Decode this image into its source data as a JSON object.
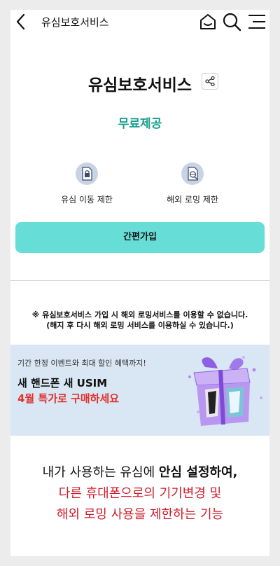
{
  "header": {
    "title": "유심보호서비스"
  },
  "service": {
    "name": "유심보호서비스",
    "price": "무료제공"
  },
  "features": [
    {
      "label": "유심 이동 제한",
      "icon": "sim-lock-icon"
    },
    {
      "label": "해외 로밍 제한",
      "icon": "roaming-block-icon"
    }
  ],
  "join_button": {
    "label": "간편가입"
  },
  "notice": {
    "line1": "※ 유심보호서비스 가입 시 해외 로밍서비스를 이용할 수 없습니다.",
    "line2": "(해지 후 다시 해외 로밍 서비스를 이용하실 수 있습니다.)"
  },
  "banner": {
    "subtitle": "기간 한정 이벤트와 최대 할인 혜택까지!",
    "title": "새 핸드폰 새 USIM",
    "highlight": "4월 특가로 구매하세요"
  },
  "description": {
    "line1_a": "내가 사용하는 유심에 ",
    "line1_b": "안심 설정하여,",
    "line2": "다른 휴대폰으로의 기기변경 및",
    "line3": "해외 로밍 사용을 제한하는 기능"
  },
  "colors": {
    "accent": "#67ddd8",
    "price": "#1a9f92",
    "red": "#cf1b2a",
    "banner_bg": "#d9e6f3"
  }
}
